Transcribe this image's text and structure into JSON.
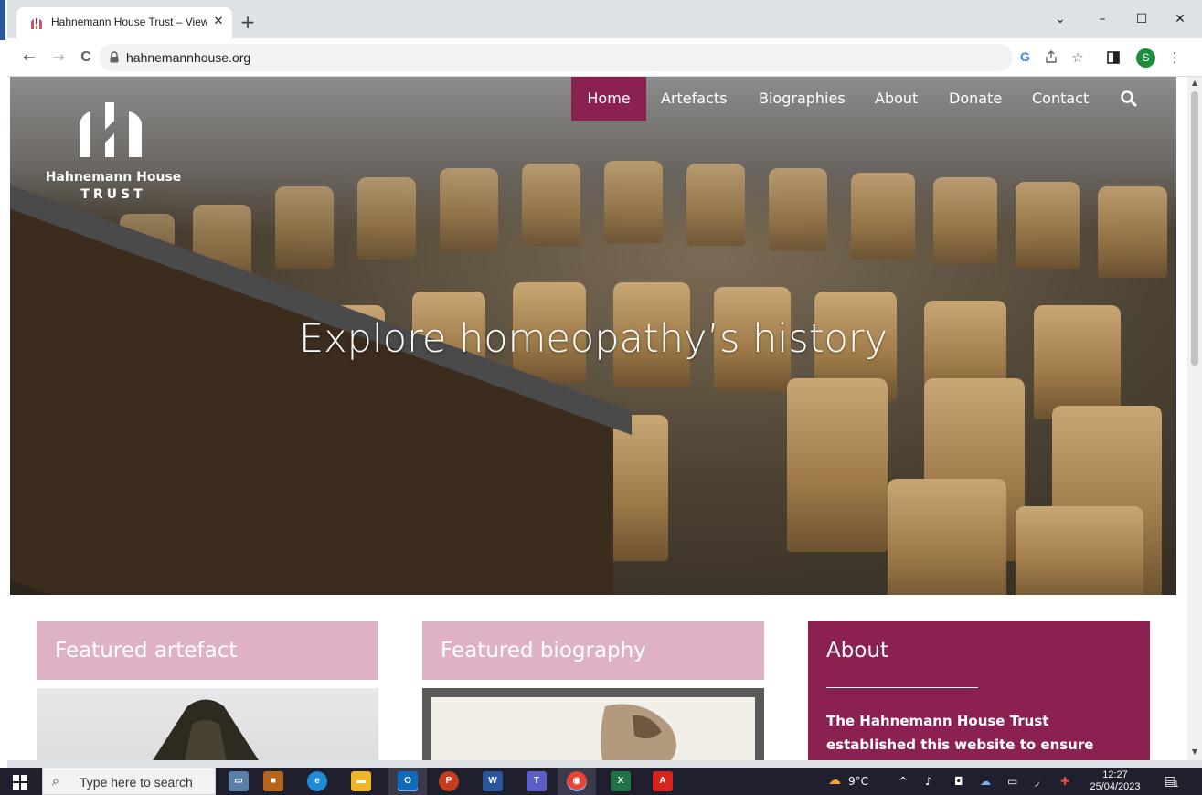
{
  "browser": {
    "tab_title": "Hahnemann House Trust – View /",
    "tab_close": "✕",
    "new_tab": "+",
    "url": "hahnemannhouse.org",
    "profile_initial": "S",
    "window_controls": {
      "dropdown": "⌄",
      "minimize": "–",
      "maximize": "☐",
      "close": "✕"
    },
    "nav": {
      "back": "←",
      "forward": "→",
      "reload": "C"
    }
  },
  "site": {
    "logo": {
      "name": "Hahnemann House",
      "sub": "TRUST"
    },
    "nav": [
      {
        "label": "Home",
        "active": true
      },
      {
        "label": "Artefacts",
        "active": false
      },
      {
        "label": "Biographies",
        "active": false
      },
      {
        "label": "About",
        "active": false
      },
      {
        "label": "Donate",
        "active": false
      },
      {
        "label": "Contact",
        "active": false
      }
    ],
    "hero_headline": "Explore homeopathy’s history",
    "cards": {
      "artefact": "Featured artefact",
      "biography": "Featured biography",
      "about_title": "About",
      "about_text": "The Hahnemann House Trust established this website to ensure"
    },
    "colors": {
      "accent": "#8b2150",
      "card_pink": "#dfb1c7"
    }
  },
  "taskbar": {
    "search_placeholder": "Type here to search",
    "weather": "9°C",
    "time": "12:27",
    "date": "25/04/2023",
    "notifications": "1"
  }
}
